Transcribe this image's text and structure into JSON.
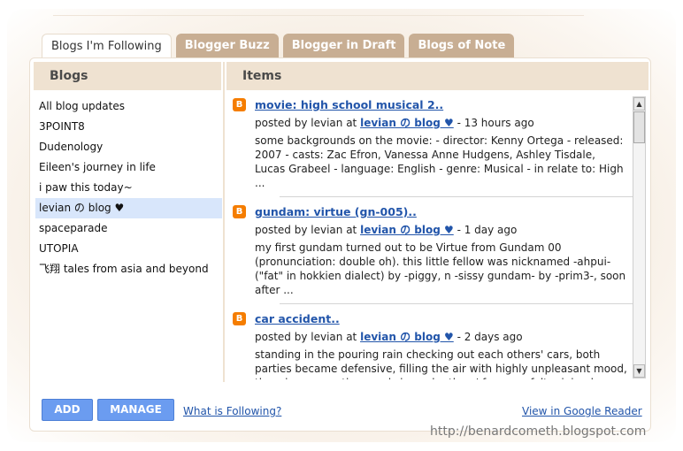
{
  "tabs": [
    {
      "label": "Blogs I'm Following",
      "active": true
    },
    {
      "label": "Blogger Buzz",
      "active": false
    },
    {
      "label": "Blogger in Draft",
      "active": false
    },
    {
      "label": "Blogs of Note",
      "active": false
    }
  ],
  "blogs_header": "Blogs",
  "items_header": "Items",
  "blogs": [
    "All blog updates",
    "3POINT8",
    "Dudenology",
    "Eileen's journey in life",
    "i paw this today~",
    "levian の blog ♥",
    "spaceparade",
    "UTOPIA",
    "飞翔 tales from asia and beyond"
  ],
  "selected_blog_index": 5,
  "items": [
    {
      "title": "movie: high school musical 2..",
      "posted_by": "posted by levian at",
      "blog": "levian の blog ♥",
      "time": " - 13 hours ago",
      "snippet": "some backgrounds on the movie: - director: Kenny Ortega - released: 2007 - casts: Zac Efron, Vanessa Anne Hudgens, Ashley Tisdale, Lucas Grabeel - language: English - genre: Musical - in relate to: High ..."
    },
    {
      "title": "gundam: virtue (gn-005)..",
      "posted_by": "posted by levian at",
      "blog": "levian の blog ♥",
      "time": " - 1 day ago",
      "snippet": "my first gundam turned out to be Virtue from Gundam 00 (pronunciation: double oh). this little fellow was nicknamed -ahpui- (\"fat\" in hokkien dialect) by -piggy, n -sissy gundam- by -prim3-, soon after ..."
    },
    {
      "title": "car accident..",
      "posted_by": "posted by levian at",
      "blog": "levian の blog ♥",
      "time": " - 2 days ago",
      "snippet": "standing in the pouring rain checking out each others' cars, both parties became defensive, filling the air with highly unpleasant mood, throwing accusative words in each others' face. we felt minimal"
    }
  ],
  "buttons": {
    "add": "ADD",
    "manage": "MANAGE"
  },
  "links": {
    "what_is_following": "What is Following?",
    "view_reader": "View in Google Reader"
  },
  "watermark": "http://benardcometh.blogspot.com",
  "icons": {
    "item": "blogger-icon",
    "scroll_up": "arrow-up-icon",
    "scroll_down": "arrow-down-icon"
  },
  "colors": {
    "tab_inactive": "#c8ae93",
    "header_bg": "#efe2d1",
    "link": "#2255aa",
    "button": "#6b9cf0",
    "selected": "#d8e6fb",
    "blogger": "#f57d00"
  }
}
